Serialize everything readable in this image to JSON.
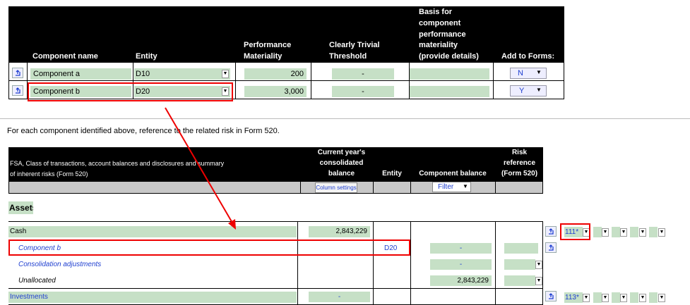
{
  "top_table": {
    "headers": {
      "component_name": "Component name",
      "entity": "Entity",
      "performance_materiality": [
        "Performance",
        "Materiality"
      ],
      "clearly_trivial": [
        "Clearly Trivial",
        "Threshold"
      ],
      "basis": [
        "Basis for",
        "component",
        "performance",
        "materiality",
        "(provide details)"
      ],
      "add_to_forms": "Add to Forms:"
    },
    "rows": [
      {
        "name": "Component a",
        "entity": "D10",
        "materiality": "200",
        "trivial": "-",
        "add": "N"
      },
      {
        "name": "Component b",
        "entity": "D20",
        "materiality": "3,000",
        "trivial": "-",
        "add": "Y"
      }
    ]
  },
  "instruction": "For each component identified above, reference to the related risk in Form 520.",
  "bottom_table": {
    "headers": {
      "fsa": [
        "FSA, Class of transactions, account balances and disclosures and summary",
        "of inherent risks (Form 520)"
      ],
      "current_year": [
        "Current year's",
        "consolidated",
        "balance"
      ],
      "entity": "Entity",
      "component_balance": "Component balance",
      "risk_ref": [
        "Risk",
        "reference",
        "(Form 520)"
      ]
    },
    "column_settings_label": "Column settings",
    "filter_label": "Filter",
    "section": "Assets",
    "rows": [
      {
        "label": "Cash",
        "balance": "2,843,229",
        "ref": "111*"
      },
      {
        "label": "Component b",
        "entity": "D20",
        "component_balance": "-"
      },
      {
        "label": "Consolidation adjustments",
        "component_balance": "-"
      },
      {
        "label": "Unallocated",
        "component_balance": "2,843,229"
      },
      {
        "label": "Investments",
        "balance": "-",
        "ref": "113*"
      }
    ]
  },
  "colors": {
    "accent_green": "#c6e0c6",
    "highlight_red": "#e00000",
    "link_blue": "#1f3fd0"
  }
}
